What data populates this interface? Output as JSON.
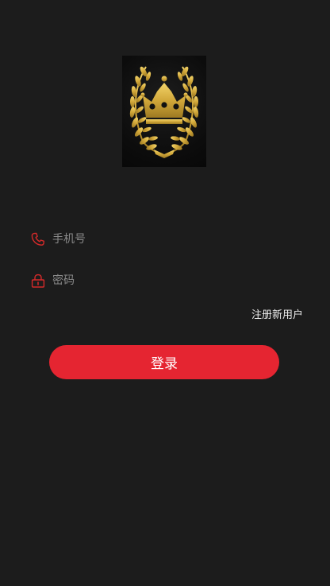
{
  "logo": {
    "icon": "crown-laurel-icon",
    "colors": {
      "gold": "#d8b240",
      "background": "#0e0e0e"
    }
  },
  "form": {
    "phone": {
      "icon": "phone-icon",
      "placeholder": "手机号",
      "value": ""
    },
    "password": {
      "icon": "lock-icon",
      "placeholder": "密码",
      "value": ""
    }
  },
  "register_link": "注册新用户",
  "login_button": "登录",
  "colors": {
    "background": "#1c1c1c",
    "accent": "#e52531",
    "icon": "#d42a2a",
    "placeholder": "#8a8a8a"
  }
}
